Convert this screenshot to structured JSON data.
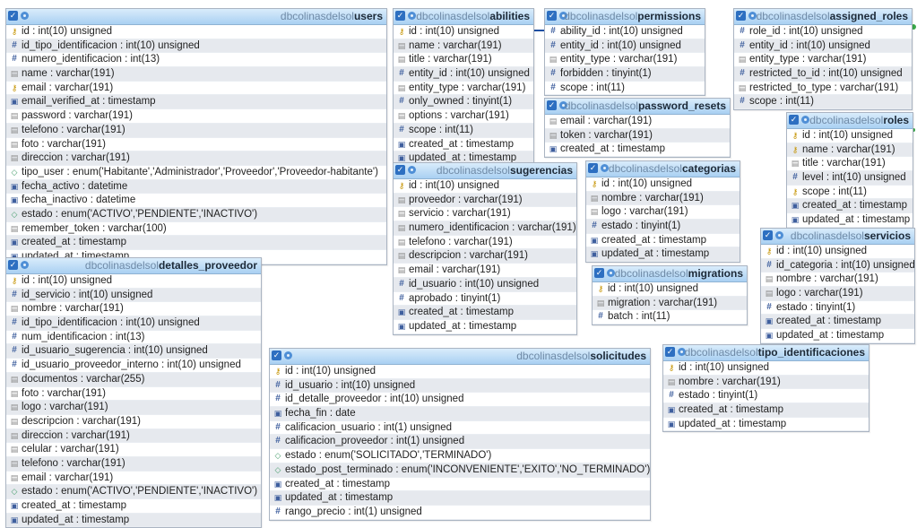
{
  "colors": {
    "header_top": "#d9ecfb",
    "header_bottom": "#a9d0f2",
    "db_name": "#6f8aa6",
    "row_alt": "#e6e9ee",
    "relation_line": "#1e4fa3",
    "relation_dot": "#3aa84a"
  },
  "icons": {
    "key": "key-icon",
    "hash": "hash-icon",
    "text": "text-icon",
    "date": "date-icon",
    "enum": "enum-icon"
  },
  "tables": [
    {
      "id": "users",
      "db": "dbcolinasdelsol",
      "name": "users",
      "fields": [
        {
          "icon": "key",
          "text": "id : int(10) unsigned"
        },
        {
          "icon": "hash",
          "text": "id_tipo_identificacion : int(10) unsigned"
        },
        {
          "icon": "hash",
          "text": "numero_identificacion : int(13)"
        },
        {
          "icon": "text",
          "text": "name : varchar(191)"
        },
        {
          "icon": "key",
          "text": "email : varchar(191)"
        },
        {
          "icon": "date",
          "text": "email_verified_at : timestamp"
        },
        {
          "icon": "text",
          "text": "password : varchar(191)"
        },
        {
          "icon": "text",
          "text": "telefono : varchar(191)"
        },
        {
          "icon": "text",
          "text": "foto : varchar(191)"
        },
        {
          "icon": "text",
          "text": "direccion : varchar(191)"
        },
        {
          "icon": "enum",
          "text": "tipo_user : enum('Habitante','Administrador','Proveedor','Proveedor-habitante')"
        },
        {
          "icon": "date",
          "text": "fecha_activo : datetime"
        },
        {
          "icon": "date",
          "text": "fecha_inactivo : datetime"
        },
        {
          "icon": "enum",
          "text": "estado : enum('ACTIVO','PENDIENTE','INACTIVO')"
        },
        {
          "icon": "text",
          "text": "remember_token : varchar(100)"
        },
        {
          "icon": "date",
          "text": "created_at : timestamp"
        },
        {
          "icon": "date",
          "text": "updated_at : timestamp"
        }
      ]
    },
    {
      "id": "detalles_proveedor",
      "db": "dbcolinasdelsol",
      "name": "detalles_proveedor",
      "fields": [
        {
          "icon": "key",
          "text": "id : int(10) unsigned"
        },
        {
          "icon": "hash",
          "text": "id_servicio : int(10) unsigned"
        },
        {
          "icon": "text",
          "text": "nombre : varchar(191)"
        },
        {
          "icon": "hash",
          "text": "id_tipo_identificacion : int(10) unsigned"
        },
        {
          "icon": "hash",
          "text": "num_identificacion : int(13)"
        },
        {
          "icon": "hash",
          "text": "id_usuario_sugerencia : int(10) unsigned"
        },
        {
          "icon": "hash",
          "text": "id_usuario_proveedor_interno : int(10) unsigned"
        },
        {
          "icon": "text",
          "text": "documentos : varchar(255)"
        },
        {
          "icon": "text",
          "text": "foto : varchar(191)"
        },
        {
          "icon": "text",
          "text": "logo : varchar(191)"
        },
        {
          "icon": "text",
          "text": "descripcion : varchar(191)"
        },
        {
          "icon": "text",
          "text": "direccion : varchar(191)"
        },
        {
          "icon": "text",
          "text": "celular : varchar(191)"
        },
        {
          "icon": "text",
          "text": "telefono : varchar(191)"
        },
        {
          "icon": "text",
          "text": "email : varchar(191)"
        },
        {
          "icon": "enum",
          "text": "estado : enum('ACTIVO','PENDIENTE','INACTIVO')"
        },
        {
          "icon": "date",
          "text": "created_at : timestamp"
        },
        {
          "icon": "date",
          "text": "updated_at : timestamp"
        }
      ]
    },
    {
      "id": "abilities",
      "db": "dbcolinasdelsol",
      "name": "abilities",
      "fields": [
        {
          "icon": "key",
          "text": "id : int(10) unsigned"
        },
        {
          "icon": "text",
          "text": "name : varchar(191)"
        },
        {
          "icon": "text",
          "text": "title : varchar(191)"
        },
        {
          "icon": "hash",
          "text": "entity_id : int(10) unsigned"
        },
        {
          "icon": "text",
          "text": "entity_type : varchar(191)"
        },
        {
          "icon": "hash",
          "text": "only_owned : tinyint(1)"
        },
        {
          "icon": "text",
          "text": "options : varchar(191)"
        },
        {
          "icon": "hash",
          "text": "scope : int(11)"
        },
        {
          "icon": "date",
          "text": "created_at : timestamp"
        },
        {
          "icon": "date",
          "text": "updated_at : timestamp"
        }
      ]
    },
    {
      "id": "permissions",
      "db": "dbcolinasdelsol",
      "name": "permissions",
      "fields": [
        {
          "icon": "hash",
          "text": "ability_id : int(10) unsigned"
        },
        {
          "icon": "hash",
          "text": "entity_id : int(10) unsigned"
        },
        {
          "icon": "text",
          "text": "entity_type : varchar(191)"
        },
        {
          "icon": "hash",
          "text": "forbidden : tinyint(1)"
        },
        {
          "icon": "hash",
          "text": "scope : int(11)"
        }
      ]
    },
    {
      "id": "password_resets",
      "db": "dbcolinasdelsol",
      "name": "password_resets",
      "fields": [
        {
          "icon": "text",
          "text": "email : varchar(191)"
        },
        {
          "icon": "text",
          "text": "token : varchar(191)"
        },
        {
          "icon": "date",
          "text": "created_at : timestamp"
        }
      ]
    },
    {
      "id": "assigned_roles",
      "db": "dbcolinasdelsol",
      "name": "assigned_roles",
      "fields": [
        {
          "icon": "hash",
          "text": "role_id : int(10) unsigned"
        },
        {
          "icon": "hash",
          "text": "entity_id : int(10) unsigned"
        },
        {
          "icon": "text",
          "text": "entity_type : varchar(191)"
        },
        {
          "icon": "hash",
          "text": "restricted_to_id : int(10) unsigned"
        },
        {
          "icon": "text",
          "text": "restricted_to_type : varchar(191)"
        },
        {
          "icon": "hash",
          "text": "scope : int(11)"
        }
      ]
    },
    {
      "id": "roles",
      "db": "dbcolinasdelsol",
      "name": "roles",
      "fields": [
        {
          "icon": "key",
          "text": "id : int(10) unsigned"
        },
        {
          "icon": "key",
          "text": "name : varchar(191)"
        },
        {
          "icon": "text",
          "text": "title : varchar(191)"
        },
        {
          "icon": "hash",
          "text": "level : int(10) unsigned"
        },
        {
          "icon": "key",
          "text": "scope : int(11)"
        },
        {
          "icon": "date",
          "text": "created_at : timestamp"
        },
        {
          "icon": "date",
          "text": "updated_at : timestamp"
        }
      ]
    },
    {
      "id": "sugerencias",
      "db": "dbcolinasdelsol",
      "name": "sugerencias",
      "fields": [
        {
          "icon": "key",
          "text": "id : int(10) unsigned"
        },
        {
          "icon": "text",
          "text": "proveedor : varchar(191)"
        },
        {
          "icon": "text",
          "text": "servicio : varchar(191)"
        },
        {
          "icon": "text",
          "text": "numero_identificacion : varchar(191)"
        },
        {
          "icon": "text",
          "text": "telefono : varchar(191)"
        },
        {
          "icon": "text",
          "text": "descripcion : varchar(191)"
        },
        {
          "icon": "text",
          "text": "email : varchar(191)"
        },
        {
          "icon": "hash",
          "text": "id_usuario : int(10) unsigned"
        },
        {
          "icon": "hash",
          "text": "aprobado : tinyint(1)"
        },
        {
          "icon": "date",
          "text": "created_at : timestamp"
        },
        {
          "icon": "date",
          "text": "updated_at : timestamp"
        }
      ]
    },
    {
      "id": "categorias",
      "db": "dbcolinasdelsol",
      "name": "categorias",
      "fields": [
        {
          "icon": "key",
          "text": "id : int(10) unsigned"
        },
        {
          "icon": "text",
          "text": "nombre : varchar(191)"
        },
        {
          "icon": "text",
          "text": "logo : varchar(191)"
        },
        {
          "icon": "hash",
          "text": "estado : tinyint(1)"
        },
        {
          "icon": "date",
          "text": "created_at : timestamp"
        },
        {
          "icon": "date",
          "text": "updated_at : timestamp"
        }
      ]
    },
    {
      "id": "migrations",
      "db": "dbcolinasdelsol",
      "name": "migrations",
      "fields": [
        {
          "icon": "key",
          "text": "id : int(10) unsigned"
        },
        {
          "icon": "text",
          "text": "migration : varchar(191)"
        },
        {
          "icon": "hash",
          "text": "batch : int(11)"
        }
      ]
    },
    {
      "id": "servicios",
      "db": "dbcolinasdelsol",
      "name": "servicios",
      "fields": [
        {
          "icon": "key",
          "text": "id : int(10) unsigned"
        },
        {
          "icon": "hash",
          "text": "id_categoria : int(10) unsigned"
        },
        {
          "icon": "text",
          "text": "nombre : varchar(191)"
        },
        {
          "icon": "text",
          "text": "logo : varchar(191)"
        },
        {
          "icon": "hash",
          "text": "estado : tinyint(1)"
        },
        {
          "icon": "date",
          "text": "created_at : timestamp"
        },
        {
          "icon": "date",
          "text": "updated_at : timestamp"
        }
      ]
    },
    {
      "id": "solicitudes",
      "db": "dbcolinasdelsol",
      "name": "solicitudes",
      "fields": [
        {
          "icon": "key",
          "text": "id : int(10) unsigned"
        },
        {
          "icon": "hash",
          "text": "id_usuario : int(10) unsigned"
        },
        {
          "icon": "hash",
          "text": "id_detalle_proveedor : int(10) unsigned"
        },
        {
          "icon": "date",
          "text": "fecha_fin : date"
        },
        {
          "icon": "hash",
          "text": "calificacion_usuario : int(1) unsigned"
        },
        {
          "icon": "hash",
          "text": "calificacion_proveedor : int(1) unsigned"
        },
        {
          "icon": "enum",
          "text": "estado : enum('SOLICITADO','TERMINADO')"
        },
        {
          "icon": "enum",
          "text": "estado_post_terminado : enum('INCONVENIENTE','EXITO','NO_TERMINADO')"
        },
        {
          "icon": "date",
          "text": "created_at : timestamp"
        },
        {
          "icon": "date",
          "text": "updated_at : timestamp"
        },
        {
          "icon": "hash",
          "text": "rango_precio : int(1) unsigned"
        }
      ]
    },
    {
      "id": "tipo_identificaciones",
      "db": "dbcolinasdelsol",
      "name": "tipo_identificaciones",
      "fields": [
        {
          "icon": "key",
          "text": "id : int(10) unsigned"
        },
        {
          "icon": "text",
          "text": "nombre : varchar(191)"
        },
        {
          "icon": "hash",
          "text": "estado : tinyint(1)"
        },
        {
          "icon": "date",
          "text": "created_at : timestamp"
        },
        {
          "icon": "date",
          "text": "updated_at : timestamp"
        }
      ]
    }
  ]
}
